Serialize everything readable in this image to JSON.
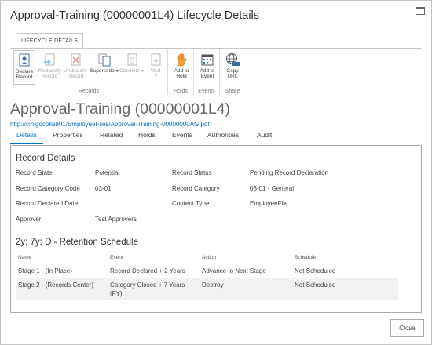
{
  "dialog": {
    "title": "Approval-Training (00000001L4) Lifecycle Details"
  },
  "ribbon": {
    "tab_label": "LIFECYCLE DETAILS",
    "groups": [
      {
        "label": "Records",
        "buttons": [
          {
            "label_1": "Declare",
            "label_2": "Record",
            "icon": "declare-record-icon"
          },
          {
            "label_1": "Reclassify",
            "label_2": "Record",
            "icon": "reclassify-record-icon"
          },
          {
            "label_1": "Undeclare",
            "label_2": "Record",
            "icon": "undeclare-record-icon"
          },
          {
            "label_1": "Supersede",
            "icon": "supersede-icon"
          },
          {
            "label_1": "Obsolete",
            "icon": "obsolete-icon"
          },
          {
            "label_1": "Vital",
            "icon": "vital-icon"
          }
        ]
      },
      {
        "label": "Holds",
        "buttons": [
          {
            "label_1": "Add to",
            "label_2": "Hold",
            "icon": "hand-hold-icon"
          }
        ]
      },
      {
        "label": "Events",
        "buttons": [
          {
            "label_1": "Add to",
            "label_2": "Event",
            "icon": "event-calendar-icon"
          }
        ]
      },
      {
        "label": "Share",
        "buttons": [
          {
            "label_1": "Copy",
            "label_2": "URL",
            "icon": "globe-url-icon"
          }
        ]
      }
    ]
  },
  "record": {
    "title": "Approval-Training (00000001L4)",
    "url": "http://cinigocollab01/EmployeeFiles/Approval-Training-00000000AG.pdf"
  },
  "tabs": [
    "Details",
    "Properties",
    "Related",
    "Holds",
    "Events",
    "Authorities",
    "Audit"
  ],
  "details": {
    "heading": "Record Details",
    "fields": {
      "record_state_label": "Record State",
      "record_state_value": "Potential",
      "record_status_label": "Record Status",
      "record_status_value": "Pending Record Declaration",
      "category_code_label": "Record Category Code",
      "category_code_value": "03-01",
      "category_label": "Record Category",
      "category_value": "03-01 - General",
      "declared_date_label": "Record Declared Date",
      "declared_date_value": "",
      "content_type_label": "Content Type",
      "content_type_value": "EmployeeFile",
      "approver_label": "Approver",
      "approver_value": "Test Approvers"
    }
  },
  "retention": {
    "heading": "2y; 7y; D - Retention Schedule",
    "columns": [
      "Name",
      "Event",
      "Action",
      "Schedule"
    ],
    "rows": [
      {
        "name": "Stage 1 - (In Place)",
        "event": "Record Declared + 2 Years",
        "event_2": "",
        "action": "Advance to Next Stage",
        "schedule": "Not Scheduled"
      },
      {
        "name": "Stage 2 - (Records Center)",
        "event": "Category Closed + 7 Years",
        "event_2": "(FY)",
        "action": "Destroy",
        "schedule": "Not Scheduled"
      }
    ]
  },
  "footer": {
    "close_label": "Close"
  }
}
